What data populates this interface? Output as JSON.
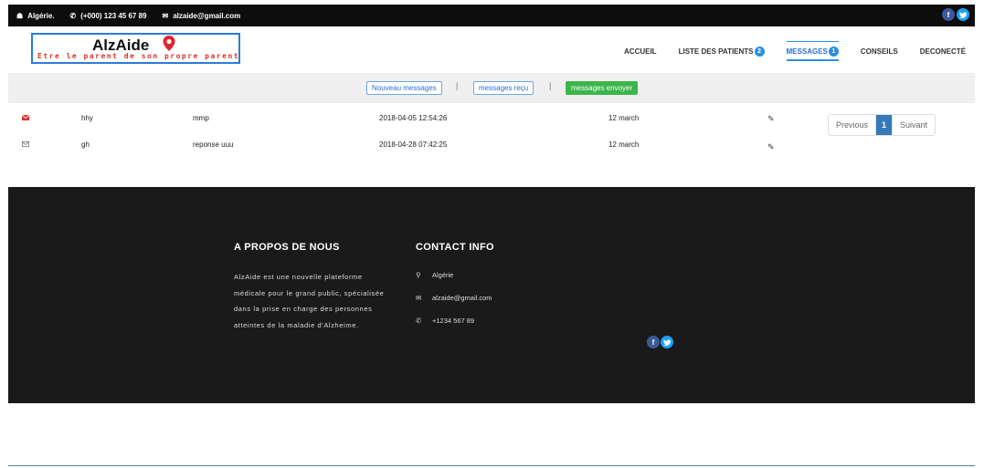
{
  "topbar": {
    "location_icon": "home-icon",
    "location": "Algérie.",
    "phone_icon": "phone-icon",
    "phone": "(+000) 123 45 67 89",
    "email_icon": "envelope-icon",
    "email": "alzaide@gmail.com",
    "social": [
      "facebook-icon",
      "twitter-icon"
    ]
  },
  "header": {
    "brand": "AlzAide",
    "tagline": "Etre le parent de son propre parent",
    "nav": [
      {
        "label": "ACCUEIL"
      },
      {
        "label": "LISTE DES PATIENTS",
        "badge": "2"
      },
      {
        "label": "MESSAGES",
        "badge": "1",
        "active": true
      },
      {
        "label": "CONSEILS"
      },
      {
        "label": "DECONECTÉ"
      }
    ]
  },
  "toolbar": {
    "new_label": "Nouveau messages",
    "received_label": "messages reçu",
    "sent_label": "messages envoyer",
    "separator": "|"
  },
  "messages": [
    {
      "to": "hhy",
      "subject": "mmp",
      "datetime": "2018-04-05 12:54:26",
      "date": "12 march",
      "unread": true
    },
    {
      "to": "gh",
      "subject": "reponse uuu",
      "datetime": "2018-04-28 07:42:25",
      "date": "12 march",
      "unread": false
    }
  ],
  "pager": {
    "prev": "Previous",
    "current": "1",
    "next": "Suivant"
  },
  "footer": {
    "about_title": "A PROPOS DE NOUS",
    "about_text": "AlzAide est une nouvelle plateforme médicale pour le grand public, spécialisée dans la prise en charge des personnes atteintes de la maladie d'Alzheime.",
    "contact_title": "CONTACT INFO",
    "contact_location": "Algérie",
    "contact_email": "alzaide@gmail.com",
    "contact_phone": "+1234 567 89"
  },
  "colors": {
    "accent": "#2b8fe0",
    "brand_red": "#d9342b",
    "green": "#3cb54a",
    "footer_bg": "#1a1a1a"
  }
}
